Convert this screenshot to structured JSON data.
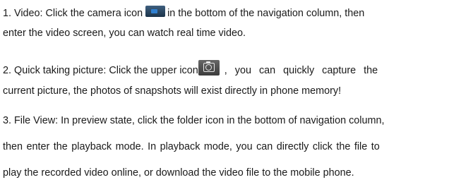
{
  "paragraphs": {
    "video": {
      "line1_before_icon": "1. Video: Click the camera icon",
      "line1_after_icon": "in the bottom of the navigation column, then",
      "line2": "enter the video screen, you can watch real time video.",
      "icon": "camera-icon"
    },
    "snapshot": {
      "line1_before_icon": "2. Quick taking picture: Click the upper icon",
      "line1_after_icon": ", you can quickly capture the",
      "line2": "current picture, the photos of snapshots will exist directly in phone memory!",
      "icon": "snapshot-camera-icon"
    },
    "file_view": {
      "line1": "3. File View: In preview state, click the folder icon in the bottom of navigation column,",
      "line2": "then enter the playback mode. In playback mode, you can directly click the file to",
      "line3": "play the recorded video online, or download the video file to the mobile phone."
    }
  }
}
